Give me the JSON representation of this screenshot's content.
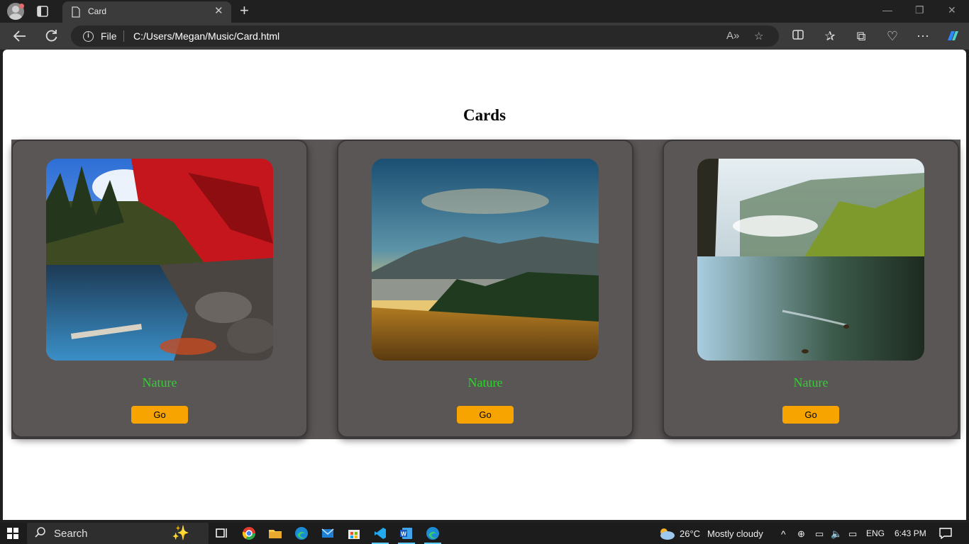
{
  "browser": {
    "tab_title": "Card",
    "address": {
      "scheme_label": "File",
      "url": "C:/Users/Megan/Music/Card.html"
    }
  },
  "page": {
    "heading": "Cards",
    "cards": [
      {
        "title": "Nature",
        "button_label": "Go",
        "image": "autumn-lake-photo"
      },
      {
        "title": "Nature",
        "button_label": "Go",
        "image": "mountain-sunrise-photo"
      },
      {
        "title": "Nature",
        "button_label": "Go",
        "image": "misty-lake-photo"
      }
    ],
    "colors": {
      "card_background": "#5a5656",
      "title_green": "#2fd12f",
      "button_orange": "#f7a400"
    }
  },
  "taskbar": {
    "search_placeholder": "Search",
    "weather_temp": "26°C",
    "weather_desc": "Mostly cloudy",
    "language": "ENG",
    "time": "6:43 PM"
  }
}
